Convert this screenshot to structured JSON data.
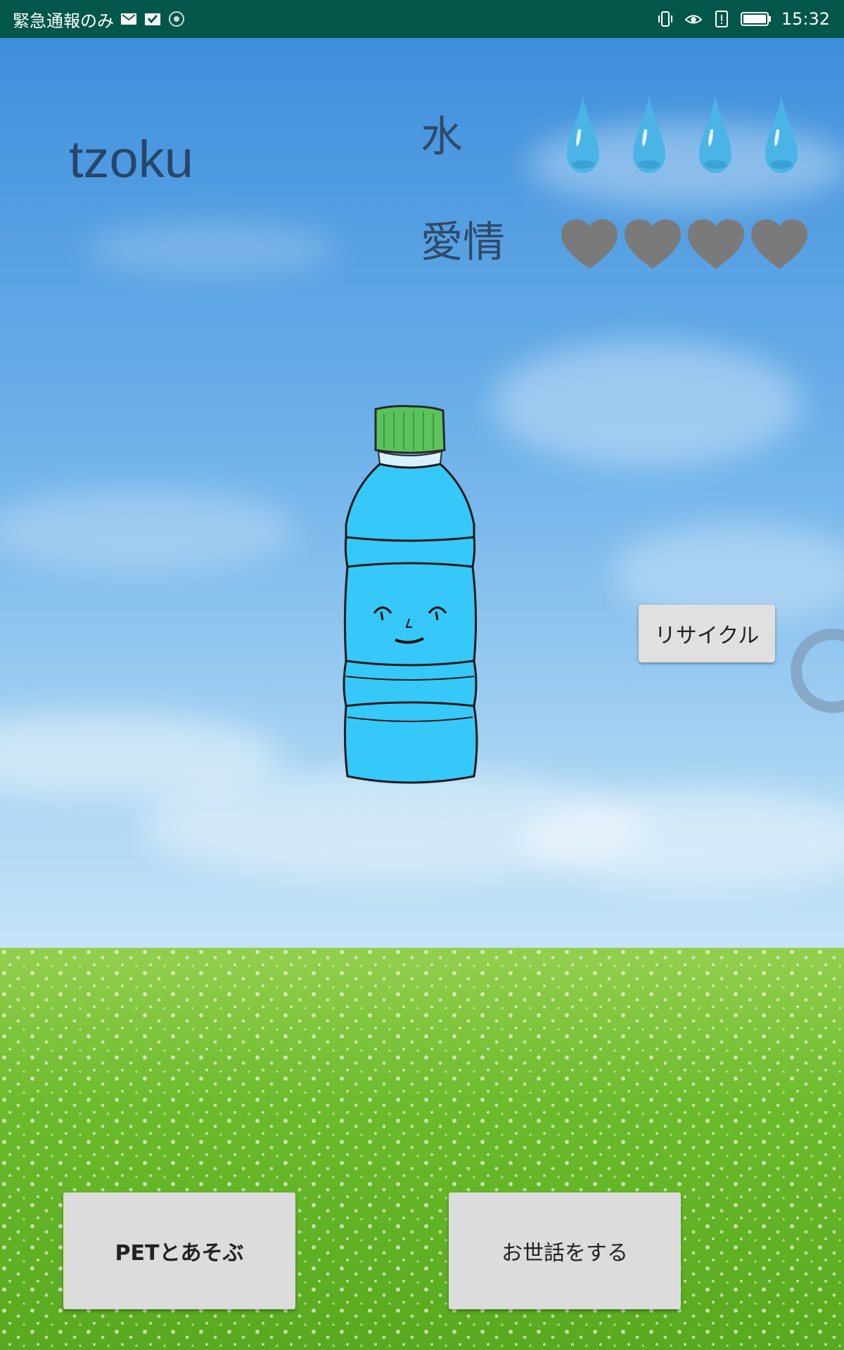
{
  "status_bar": {
    "carrier_text": "緊急通報のみ",
    "time": "15:32",
    "left_icons": [
      "mail-icon",
      "check-mail-icon",
      "sync-icon"
    ],
    "right_icons": [
      "vibrate-icon",
      "eye-icon",
      "alert-icon",
      "battery-icon"
    ]
  },
  "pet": {
    "name": "tzoku"
  },
  "stats": {
    "water_label": "水",
    "love_label": "愛情",
    "water_level": 4,
    "love_level": 4,
    "love_filled": 0
  },
  "buttons": {
    "recycle": "リサイクル",
    "play": "PETとあそぶ",
    "care": "お世話をする"
  },
  "colors": {
    "status_bar": "#02574a",
    "drop": "#4ab4e6",
    "heart_empty": "#7a7a7a",
    "bottle_body": "#36c8f8",
    "bottle_cap": "#5cc25c",
    "button_bg": "#dcdcdc"
  }
}
